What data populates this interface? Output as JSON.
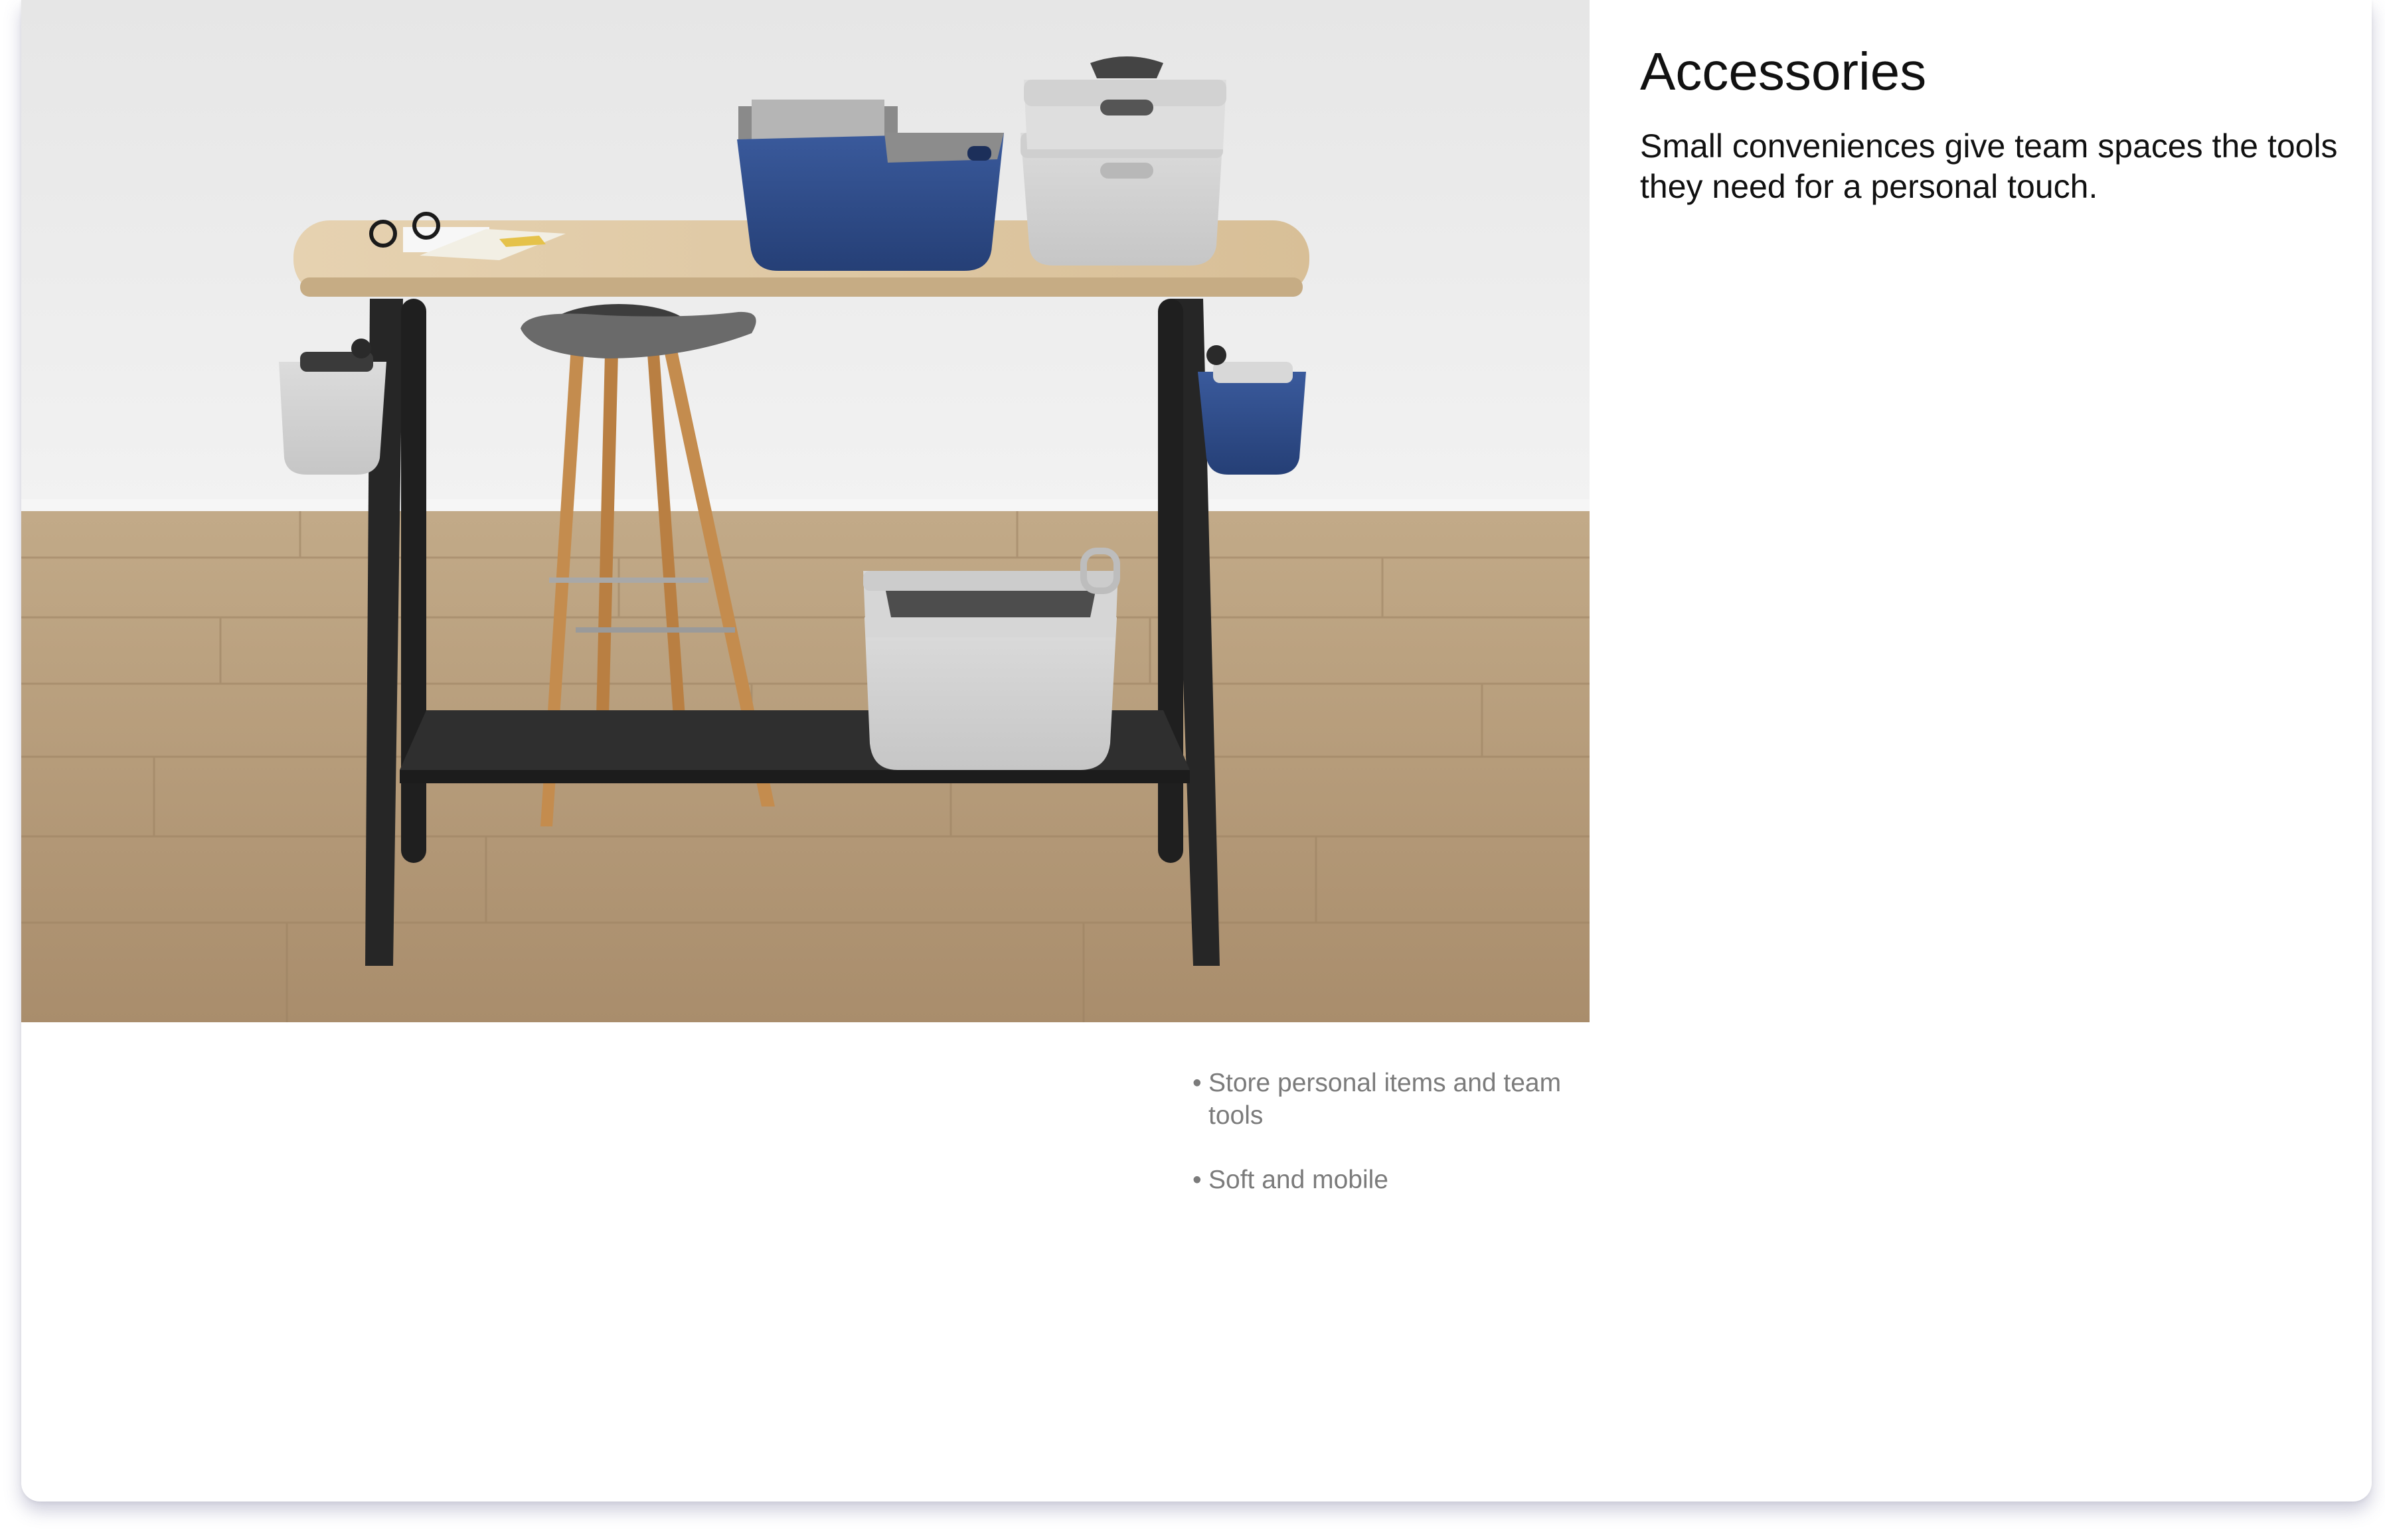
{
  "section": {
    "title": "Accessories",
    "description": "Small conveniences give team spaces the tools they need for a personal touch."
  },
  "features": [
    {
      "bullet": "•",
      "text": "Store personal items and team tools"
    },
    {
      "bullet": "•",
      "text": "Soft and mobile"
    }
  ],
  "colors": {
    "wall": "#ebebeb",
    "floor": "#b49a7a",
    "tabletop": "#dcc4a0",
    "frame": "#262626",
    "felt_blue": "#2e4a86",
    "felt_gray": "#d4d4d4",
    "text_primary": "#111111",
    "text_secondary": "#7b7b7b"
  }
}
